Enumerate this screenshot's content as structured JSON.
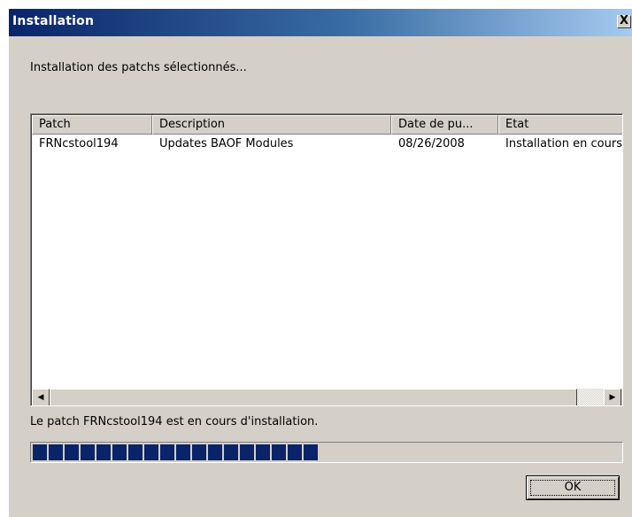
{
  "window": {
    "title": "Installation",
    "close_glyph": "X"
  },
  "instruction": "Installation des patchs sélectionnés...",
  "list": {
    "columns": [
      "Patch",
      "Description",
      "Date de pu...",
      "Etat"
    ],
    "rows": [
      [
        "FRNcstool194",
        "Updates BAOF Modules",
        "08/26/2008",
        "Installation en cours"
      ]
    ]
  },
  "scrollbar": {
    "left_icon": "arrow-left-icon",
    "right_icon": "arrow-right-icon",
    "left_glyph": "◀",
    "right_glyph": "▶"
  },
  "status_text": "Le patch FRNcstool194 est en cours d'installation.",
  "progress": {
    "fraction": 0.5,
    "color": "#0a246a"
  },
  "buttons": {
    "ok_label": "OK"
  },
  "colors": {
    "title_start": "#0a246a",
    "title_end": "#a6caf0",
    "face": "#d4d0c8"
  }
}
